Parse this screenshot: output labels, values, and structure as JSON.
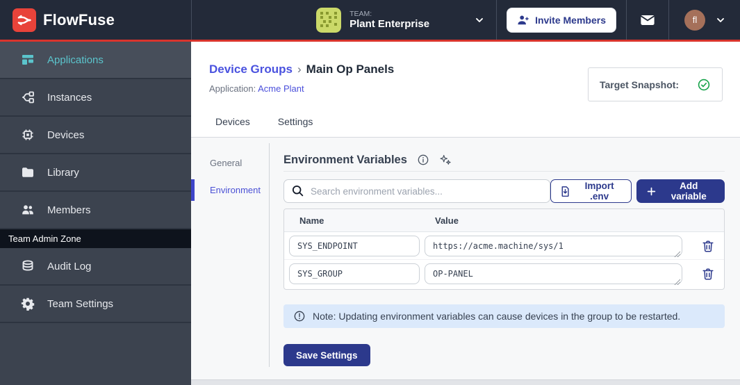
{
  "colors": {
    "header_bg": "#232A39",
    "sidebar_bg": "#3C434F",
    "accent_red": "#D9342C",
    "active_teal": "#5BC4CC",
    "primary_indigo": "#2C398C",
    "link_indigo": "#4A52DF",
    "note_bg": "#DBE9FB",
    "success_green": "#16A34A",
    "content_bg": "#F7F8F9"
  },
  "header": {
    "brand": "FlowFuse",
    "team": {
      "label": "TEAM:",
      "name": "Plant Enterprise"
    },
    "invite_label": "Invite Members",
    "avatar_initials": "fl"
  },
  "sidebar": {
    "items": [
      {
        "label": "Applications",
        "active": true
      },
      {
        "label": "Instances",
        "active": false
      },
      {
        "label": "Devices",
        "active": false
      },
      {
        "label": "Library",
        "active": false
      },
      {
        "label": "Members",
        "active": false
      }
    ],
    "admin_zone": {
      "label": "Team Admin Zone",
      "items": [
        {
          "label": "Audit Log"
        },
        {
          "label": "Team Settings"
        }
      ]
    }
  },
  "main": {
    "breadcrumb": {
      "parent": "Device Groups",
      "separator": "›",
      "current": "Main Op Panels"
    },
    "application": {
      "label": "Application:",
      "name": "Acme Plant"
    },
    "target_snapshot": {
      "label": "Target Snapshot:"
    },
    "tabs": [
      {
        "label": "Devices"
      },
      {
        "label": "Settings"
      }
    ],
    "subnav": [
      {
        "label": "General"
      },
      {
        "label": "Environment",
        "active": true
      }
    ],
    "env": {
      "title": "Environment Variables",
      "search_placeholder": "Search environment variables...",
      "import_label": "Import .env",
      "add_label": "Add variable",
      "columns": {
        "name": "Name",
        "value": "Value"
      },
      "rows": [
        {
          "name": "SYS_ENDPOINT",
          "value": "https://acme.machine/sys/1"
        },
        {
          "name": "SYS_GROUP",
          "value": "OP-PANEL"
        }
      ],
      "note": "Note: Updating environment variables can cause devices in the group to be restarted.",
      "save_label": "Save Settings"
    }
  }
}
